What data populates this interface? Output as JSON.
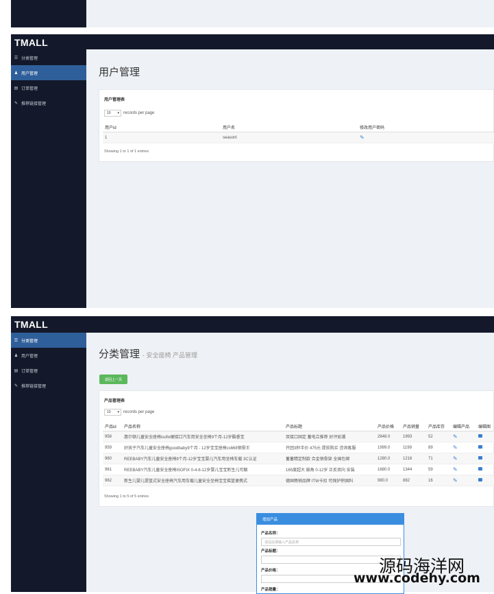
{
  "brand": "TMALL",
  "nav": {
    "categories": "分类管理",
    "users": "用户管理",
    "orders": "订单管理",
    "links": "推荐链接管理"
  },
  "icons": {
    "categories": "list-icon",
    "users": "user-icon",
    "orders": "card-icon",
    "links": "link-icon"
  },
  "colors": {
    "sidebar": "#13192a",
    "active_nav": "#2f5f9a",
    "content_bg": "#eef1f5",
    "button_green": "#5cb85c",
    "accent_blue": "#3a8ee0"
  },
  "user_panel": {
    "page_title": "用户管理",
    "card_title": "用户管理表",
    "page_size": "10",
    "records_per_page": "records per page",
    "columns": [
      "用户id",
      "用户名",
      "修改用户密码"
    ],
    "rows": [
      {
        "id": "1",
        "name": "seasonl"
      }
    ],
    "info": "Showing 1 to 1 of 1 entries"
  },
  "product_panel": {
    "page_title": "分类管理",
    "page_subtitle": "- 安全座椅 产品管理",
    "back_button": "返回上一页",
    "card_title": "产品管理表",
    "page_size": "10",
    "records_per_page": "records per page",
    "columns": [
      "产品id",
      "产品名称",
      "产品标题",
      "产品价格",
      "产品销量",
      "产品库存",
      "编辑产品",
      "编辑图"
    ],
    "rows": [
      {
        "id": "958",
        "name": "惠尔顿儿童安全座椅isofix硬接口汽车用安全坐椅9个月-12岁酷睿宝",
        "title": "双接口固定 蓄电立推荐 好评如潮",
        "price": "2848.0",
        "sales": "1993",
        "stock": "52"
      },
      {
        "id": "959",
        "name": "好孩子汽车儿童安全座椅goodbaby9个月 - 12岁宝宝座椅cs668钢骨王",
        "title": "开团3秒半价 475元 提前购买 咨询客服",
        "price": "1999.0",
        "sales": "1199",
        "stock": "89"
      },
      {
        "id": "960",
        "name": "REEBABY汽车儿童安全座椅9个月-12岁宝宝婴儿汽车用坐椅车载 3C认证",
        "title": "蓄蓄精定制款 合金钢骨架 全国包邮",
        "price": "1280.0",
        "sales": "1216",
        "stock": "71"
      },
      {
        "id": "961",
        "name": "REEBABY汽车儿童安全座椅ISOFIX 0-4-6-12岁婴儿宝宝新生儿可躺",
        "title": "165度超大 鼓角 0-12岁 正反双向 安装",
        "price": "1680.0",
        "sales": "1344",
        "stock": "59"
      },
      {
        "id": "962",
        "name": "新生儿婴儿提篮式安全座椅汽车用车载儿童安全坐椅宝宝摇篮便携式",
        "title": "德国畅销品牌 ITW卡扣 可保护积固料",
        "price": "980.0",
        "sales": "882",
        "stock": "16"
      }
    ],
    "info": "Showing 1 to 5 of 5 entries"
  },
  "add_form": {
    "title": "增加产品",
    "name_label": "产品名称：",
    "name_placeholder": "请在此填输入产品名称",
    "subtitle_label": "产品标题：",
    "price_label": "产品价格：",
    "sales_label": "产品销量："
  },
  "watermark": {
    "cn": "源码海洋网",
    "url": "www.codehy.com"
  }
}
